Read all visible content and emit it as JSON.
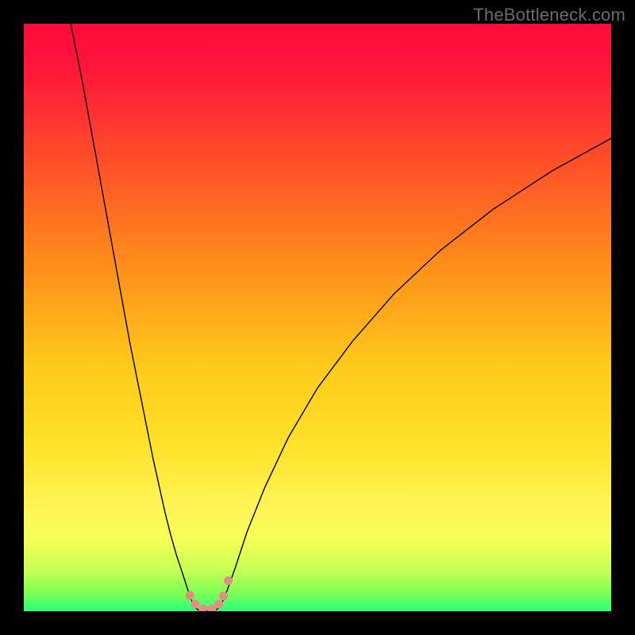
{
  "watermark": "TheBottleneck.com",
  "chart_data": {
    "type": "line",
    "title": "",
    "xlabel": "",
    "ylabel": "",
    "xlim": [
      0,
      100
    ],
    "ylim": [
      0,
      100
    ],
    "background_gradient": {
      "stops": [
        {
          "pos": 0.0,
          "color": "#ff0a3a"
        },
        {
          "pos": 0.08,
          "color": "#ff173a"
        },
        {
          "pos": 0.22,
          "color": "#ff4a2a"
        },
        {
          "pos": 0.4,
          "color": "#ff8a1a"
        },
        {
          "pos": 0.58,
          "color": "#ffc91a"
        },
        {
          "pos": 0.72,
          "color": "#ffe22a"
        },
        {
          "pos": 0.82,
          "color": "#fff455"
        },
        {
          "pos": 0.88,
          "color": "#f4ff55"
        },
        {
          "pos": 0.93,
          "color": "#c8ff55"
        },
        {
          "pos": 0.97,
          "color": "#7aff55"
        },
        {
          "pos": 1.0,
          "color": "#2aff7b"
        }
      ]
    },
    "series": [
      {
        "name": "left-curve",
        "color": "#000000",
        "width": 1.4,
        "x": [
          8,
          10,
          12,
          14,
          16,
          18,
          20,
          22,
          24,
          25,
          26,
          27,
          27.8,
          28.4,
          28.9
        ],
        "y": [
          100,
          90,
          79,
          68,
          57,
          46,
          36,
          26,
          17,
          13,
          9.5,
          6.5,
          4,
          2.2,
          1.2
        ]
      },
      {
        "name": "right-curve",
        "color": "#000000",
        "width": 1.4,
        "x": [
          33.6,
          34.2,
          35,
          36,
          38,
          41,
          45,
          50,
          56,
          63,
          71,
          80,
          90,
          100
        ],
        "y": [
          1.2,
          2.4,
          4.6,
          7.4,
          13.5,
          21,
          29.5,
          38,
          46,
          54,
          61.5,
          68.5,
          75,
          80.5
        ]
      },
      {
        "name": "bottom-arc",
        "color": "#000000",
        "width": 1.4,
        "x": [
          28.9,
          29.4,
          30.0,
          30.8,
          31.6,
          32.4,
          33.0,
          33.6
        ],
        "y": [
          1.2,
          0.4,
          0.1,
          0.0,
          0.0,
          0.1,
          0.4,
          1.2
        ]
      }
    ],
    "markers": [
      {
        "name": "salmon-dot",
        "x": 28.3,
        "y": 2.7,
        "r": 5.5,
        "color": "#e98b85"
      },
      {
        "name": "salmon-dot",
        "x": 29.2,
        "y": 1.2,
        "r": 5.5,
        "color": "#e98b85"
      },
      {
        "name": "salmon-dot",
        "x": 30.5,
        "y": 0.4,
        "r": 5.5,
        "color": "#e98b85"
      },
      {
        "name": "salmon-dot",
        "x": 32.0,
        "y": 0.4,
        "r": 5.5,
        "color": "#e98b85"
      },
      {
        "name": "salmon-dot",
        "x": 33.2,
        "y": 1.2,
        "r": 5.5,
        "color": "#e98b85"
      },
      {
        "name": "salmon-dot",
        "x": 34.0,
        "y": 2.6,
        "r": 5.5,
        "color": "#e98b85"
      },
      {
        "name": "salmon-dot",
        "x": 34.8,
        "y": 5.2,
        "r": 5.5,
        "color": "#e98b85"
      }
    ]
  }
}
